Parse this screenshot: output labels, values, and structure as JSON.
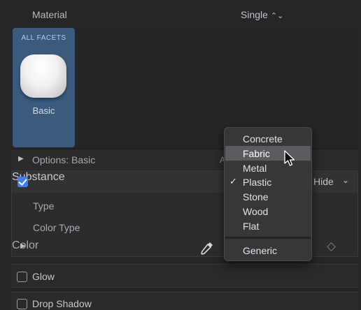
{
  "header": {
    "label": "Material",
    "selector_value": "Single",
    "selector_chevron": "⌃⌄"
  },
  "tile": {
    "caption": "ALL FACETS",
    "name": "Basic"
  },
  "options_row": {
    "label": "Options: Basic",
    "truncated_label": "A"
  },
  "substance": {
    "label": "Substance",
    "checked": true,
    "right_label": "Hide",
    "right_chevron": "⌄"
  },
  "rows": {
    "type": "Type",
    "color_type": "Color Type",
    "color": "Color"
  },
  "glow": {
    "label": "Glow",
    "checked": false
  },
  "drop_shadow": {
    "label": "Drop Shadow",
    "checked": false
  },
  "menu": {
    "items": [
      {
        "label": "Concrete",
        "checked": false,
        "highlighted": false
      },
      {
        "label": "Fabric",
        "checked": false,
        "highlighted": true
      },
      {
        "label": "Metal",
        "checked": false,
        "highlighted": false
      },
      {
        "label": "Plastic",
        "checked": true,
        "highlighted": false
      },
      {
        "label": "Stone",
        "checked": false,
        "highlighted": false
      },
      {
        "label": "Wood",
        "checked": false,
        "highlighted": false
      },
      {
        "label": "Flat",
        "checked": false,
        "highlighted": false
      }
    ],
    "footer_item": {
      "label": "Generic"
    },
    "check_glyph": "✓"
  },
  "colors": {
    "accent": "#3e7ef5",
    "tile_bg": "#3a5a7e",
    "menu_highlight": "#5c5c60"
  }
}
